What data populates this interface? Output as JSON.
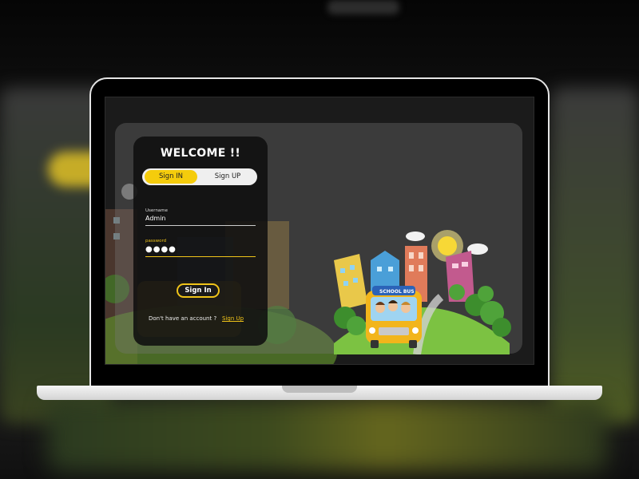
{
  "login": {
    "title": "WELCOME !!",
    "tabs": {
      "sign_in": "Sign IN",
      "sign_up": "Sign UP",
      "active": "sign_in"
    },
    "username": {
      "label": "Username",
      "value": "Admin"
    },
    "password": {
      "label": "password",
      "value": "●●●●"
    },
    "submit_label": "Sign In",
    "footer_text": "Don't have an account ?",
    "signup_link": "Sign Up"
  },
  "illustration": {
    "bus_sign": "SCHOOL BUS"
  },
  "colors": {
    "accent": "#f5cc0c",
    "card": "#0f0f0f",
    "laptop": "#e5e5e5",
    "grass": "#7cc242"
  }
}
